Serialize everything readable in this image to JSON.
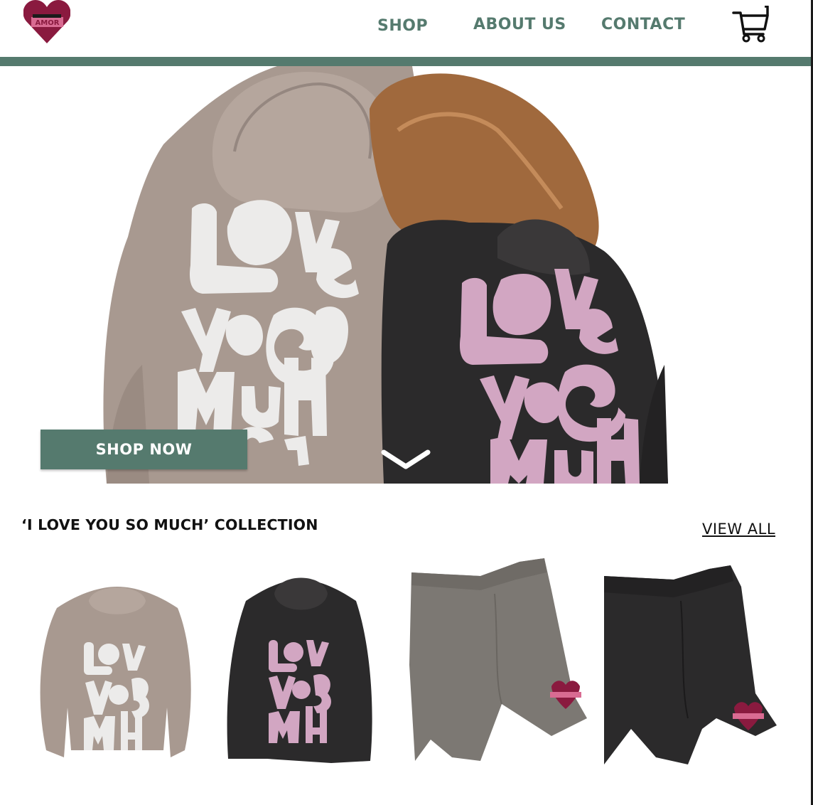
{
  "brand": {
    "logo_text": "AMOR",
    "heart_color": "#8a1a3f",
    "tag_color": "#d96b92"
  },
  "nav": {
    "shop": "SHOP",
    "about": "ABOUT US",
    "contact": "CONTACT"
  },
  "colors": {
    "accent": "#557a6e",
    "hoodie_tan": "#a89990",
    "hoodie_black": "#2b2a2b",
    "print_light": "#ecebea",
    "print_pink": "#d2a6c2"
  },
  "hero": {
    "print_lines": [
      "LOVE",
      "YOU SO",
      "MUCH"
    ],
    "cta_label": "SHOP NOW"
  },
  "collection": {
    "title": "‘I LOVE YOU SO MUCH’ COLLECTION",
    "view_all": "VIEW ALL"
  },
  "icons": {
    "cart": "shopping-cart-icon",
    "scroll": "chevron-down-icon"
  }
}
